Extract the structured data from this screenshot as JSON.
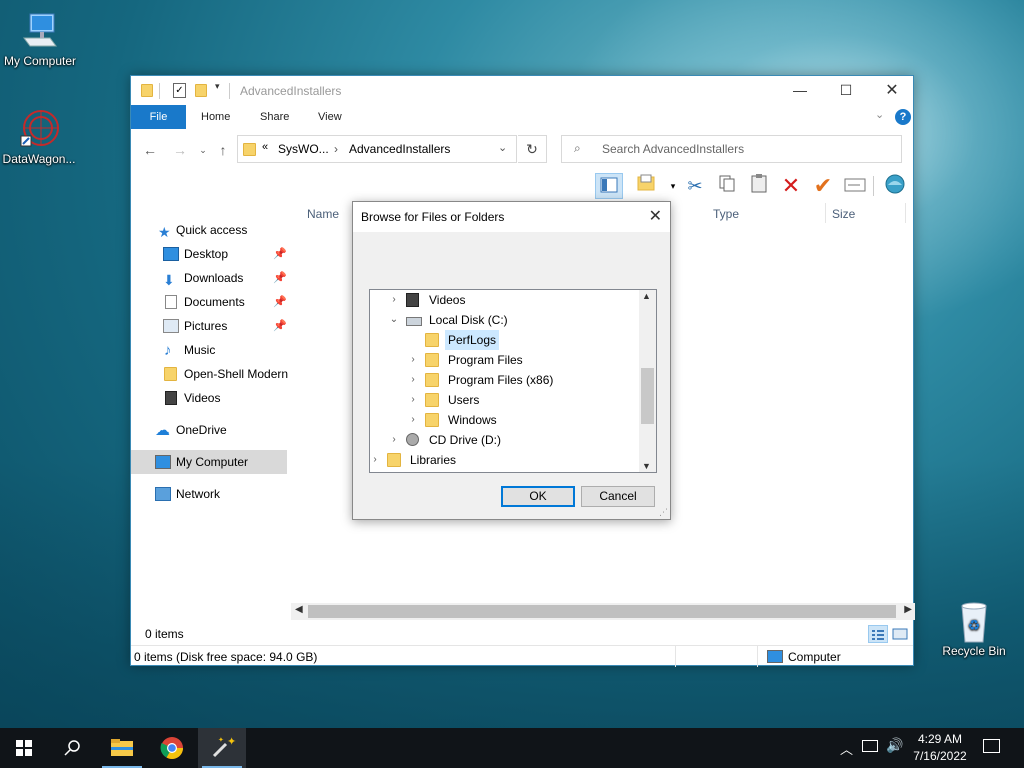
{
  "desktop": {
    "icons": [
      {
        "label": "My Computer"
      },
      {
        "label": "DataWagon..."
      },
      {
        "label": "Recycle Bin"
      }
    ]
  },
  "explorer": {
    "title": "AdvancedInstallers",
    "tabs": [
      "File",
      "Home",
      "Share",
      "View"
    ],
    "address": {
      "crumb1": "SysWO...",
      "crumb2": "AdvancedInstallers",
      "overflow": "«"
    },
    "search_placeholder": "Search AdvancedInstallers",
    "nav": {
      "quick_access": "Quick access",
      "items": [
        "Desktop",
        "Downloads",
        "Documents",
        "Pictures",
        "Music",
        "Open-Shell Modern",
        "Videos"
      ],
      "onedrive": "OneDrive",
      "my_computer": "My Computer",
      "network": "Network"
    },
    "columns": {
      "name": "Name",
      "type": "Type",
      "size": "Size"
    },
    "status_count": "0 items",
    "status_bar": "0 items (Disk free space: 94.0 GB)",
    "status_location": "Computer"
  },
  "dialog": {
    "title": "Browse for Files or Folders",
    "tree": [
      {
        "label": "Videos"
      },
      {
        "label": "Local Disk (C:)"
      },
      {
        "label": "PerfLogs"
      },
      {
        "label": "Program Files"
      },
      {
        "label": "Program Files (x86)"
      },
      {
        "label": "Users"
      },
      {
        "label": "Windows"
      },
      {
        "label": "CD Drive (D:)"
      },
      {
        "label": "Libraries"
      }
    ],
    "ok_label": "OK",
    "cancel_label": "Cancel"
  },
  "taskbar": {
    "time": "4:29 AM",
    "date": "7/16/2022"
  },
  "colors": {
    "accent": "#1979ca",
    "selection": "#cce8ff",
    "taskbar": "#101418"
  }
}
